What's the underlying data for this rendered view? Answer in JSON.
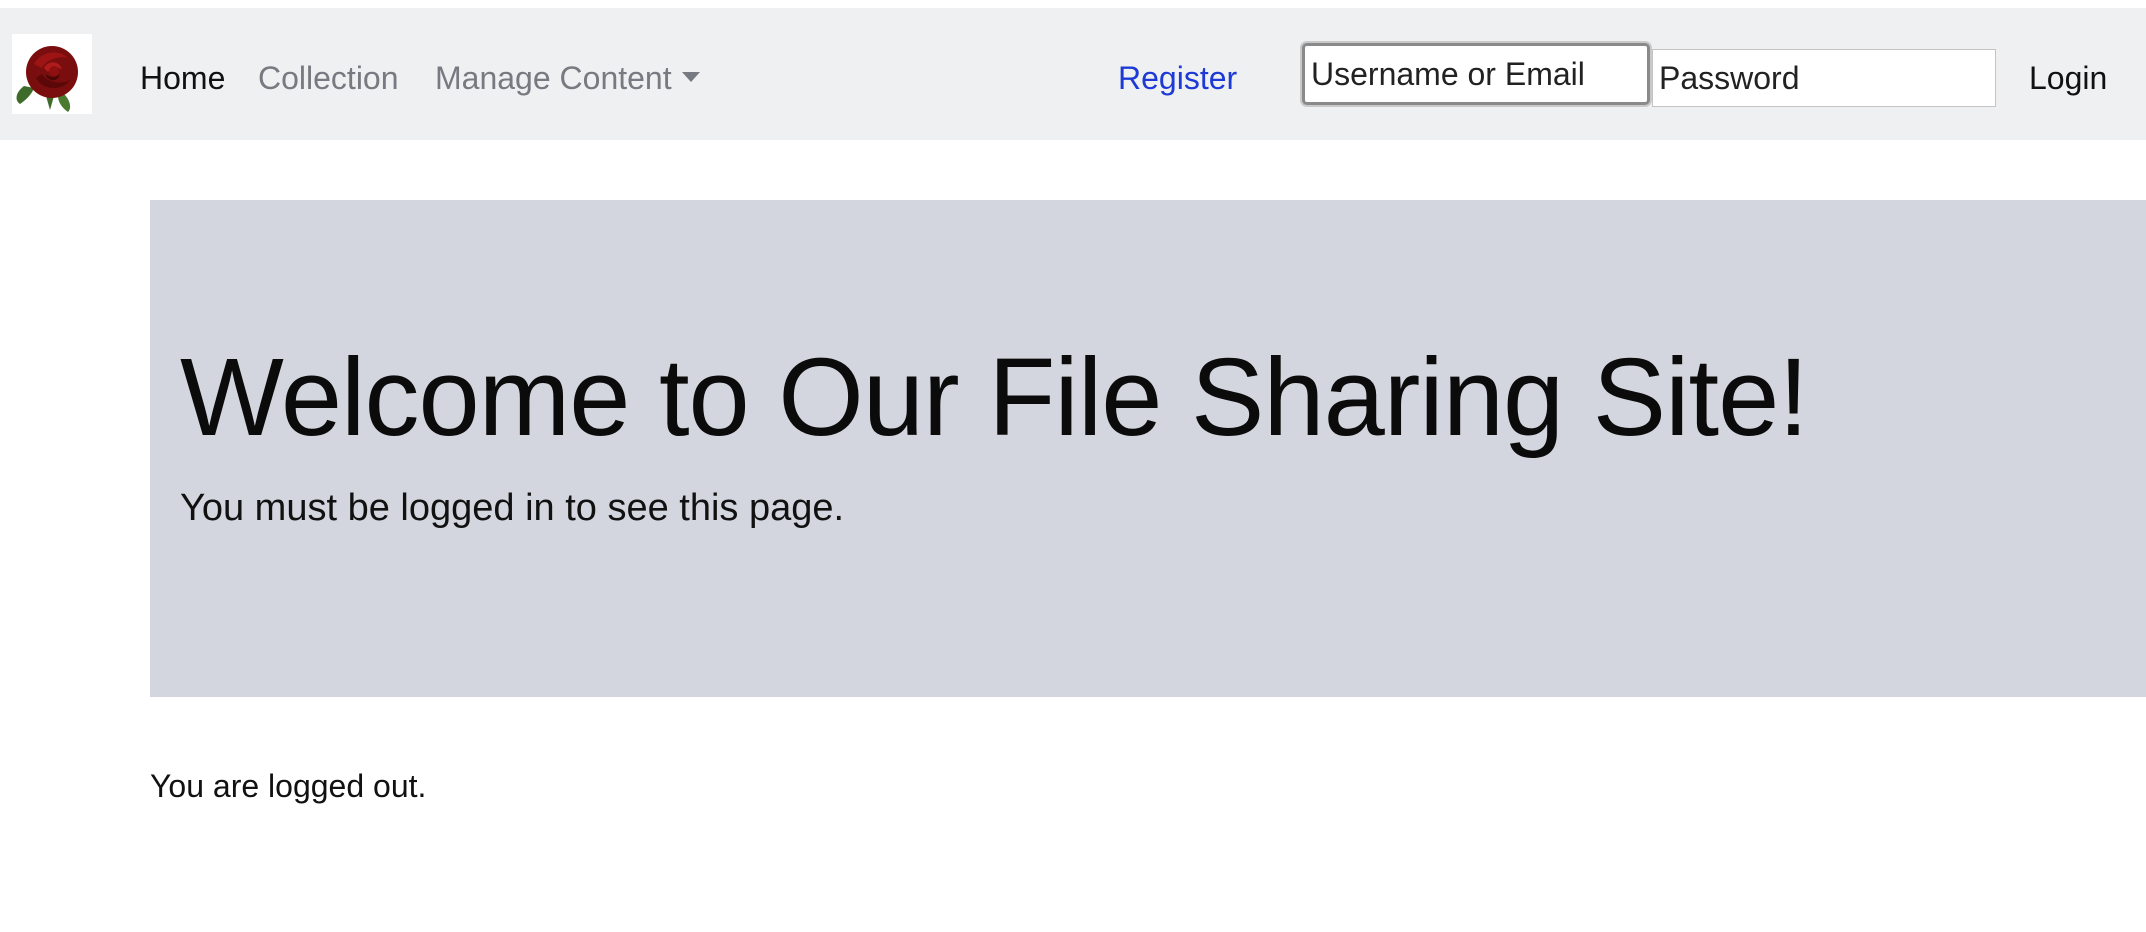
{
  "nav": {
    "home": "Home",
    "collection": "Collection",
    "manage_content": "Manage Content",
    "register": "Register",
    "login": "Login",
    "username_placeholder": "Username or Email",
    "password_placeholder": "Password"
  },
  "jumbotron": {
    "title": "Welcome to Our File Sharing Site!",
    "message": "You must be logged in to see this page."
  },
  "status": "You are logged out.",
  "colors": {
    "navbar_bg": "#eff0f2",
    "register_link": "#1d3ad6",
    "jumbotron_bg": "#d3d6de"
  },
  "icons": {
    "logo": "rose-logo-icon",
    "dropdown": "caret-down-icon"
  }
}
